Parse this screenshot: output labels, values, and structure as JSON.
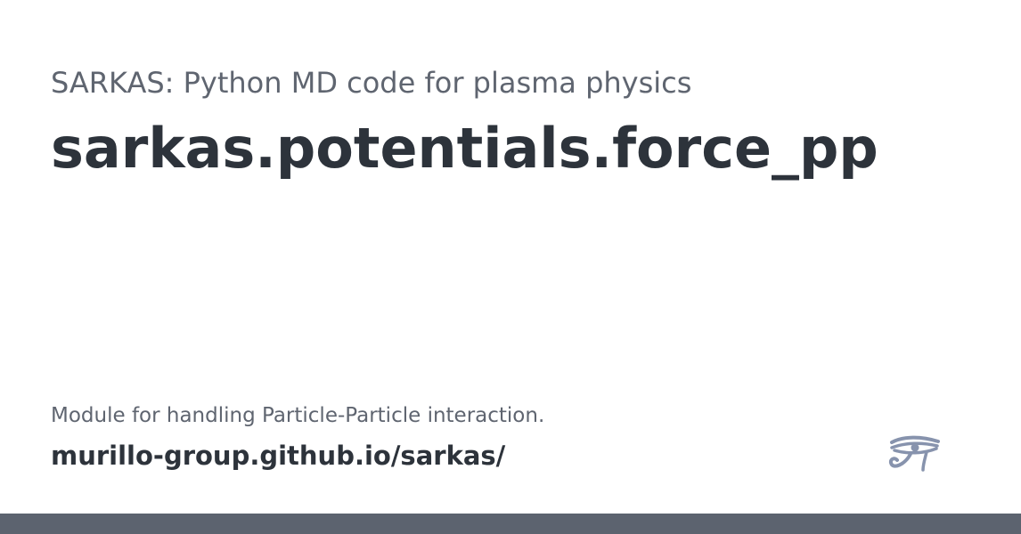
{
  "header": {
    "site_title": "SARKAS: Python MD code for plasma physics",
    "page_title": "sarkas.potentials.force_pp"
  },
  "footer": {
    "description": "Module for handling Particle-Particle interaction.",
    "url": "murillo-group.github.io/sarkas/"
  },
  "logo": {
    "icon": "eye-of-horus-icon",
    "color": "#8793ad"
  },
  "colors": {
    "title": "#2d333b",
    "subtitle": "#5f6570",
    "bottom_bar": "#5c636f",
    "background": "#ffffff"
  }
}
